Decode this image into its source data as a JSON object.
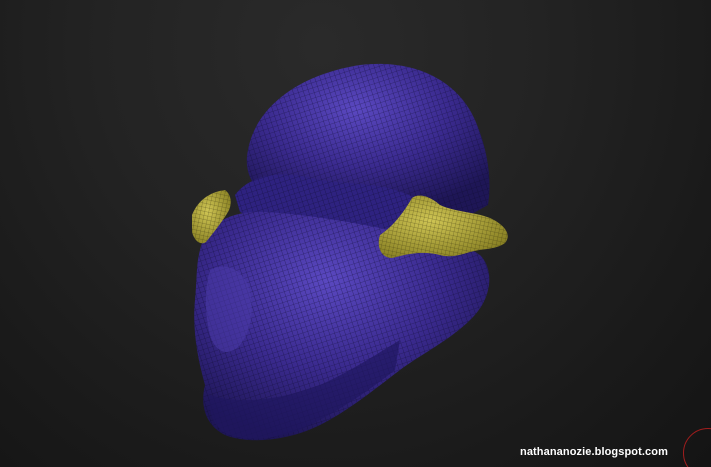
{
  "viewport": {
    "model": "sculpt-mesh-head",
    "colors": {
      "mesh_main": "#3a2a8e",
      "mesh_shadow": "#20175a",
      "mesh_highlight": "#5a48c0",
      "mesh_ears": "#b7ad3a",
      "wire": "#0d0a2a",
      "background": "#232323"
    }
  },
  "watermark": {
    "text": "nathananozie.blogspot.com"
  },
  "corner_indicator": {
    "color": "#a11d1d"
  }
}
